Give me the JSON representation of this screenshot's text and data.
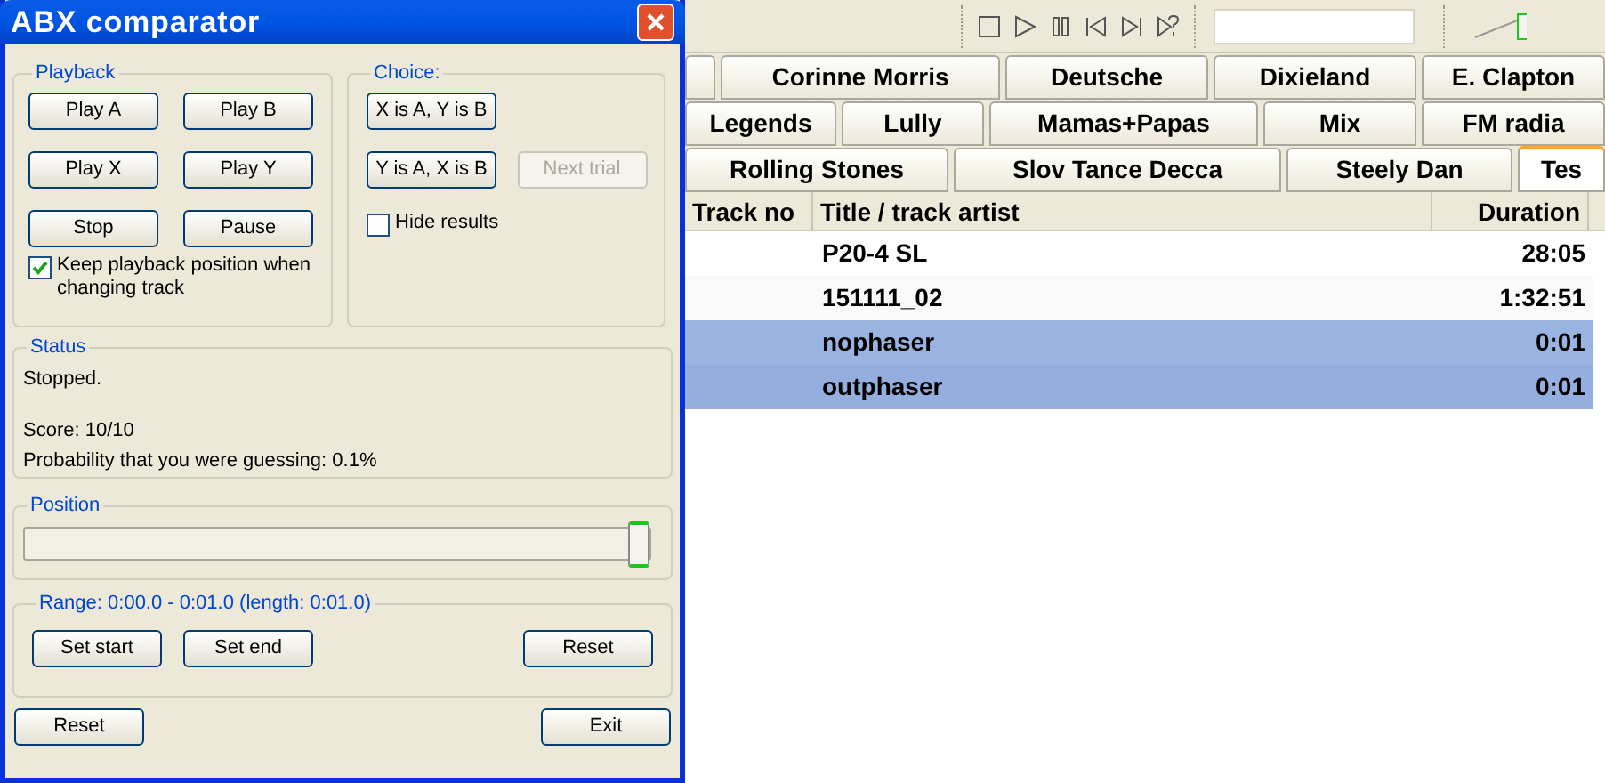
{
  "dialog": {
    "title": "ABX comparator",
    "playback": {
      "label": "Playback",
      "buttons": [
        "Play A",
        "Play B",
        "Play X",
        "Play Y",
        "Stop",
        "Pause"
      ],
      "keep_position": {
        "label": "Keep playback position when changing track",
        "checked": true
      }
    },
    "choice": {
      "label": "Choice:",
      "buttons": [
        {
          "label": "X is A, Y is B",
          "disabled": false
        },
        {
          "label": "Y is A, X is B",
          "disabled": false
        },
        {
          "label": "Next trial",
          "disabled": true
        }
      ],
      "hide_results": {
        "label": "Hide results",
        "checked": false
      }
    },
    "status": {
      "label": "Status",
      "state": "Stopped.",
      "score": "Score: 10/10",
      "probability": "Probability that you were guessing: 0.1%"
    },
    "position": {
      "label": "Position",
      "level": 1
    },
    "range": {
      "label": "Range: 0:00.0 - 0:01.0 (length: 0:01.0)",
      "buttons": [
        "Set start",
        "Set end",
        "Reset"
      ]
    },
    "footer_buttons": [
      "Reset",
      "Exit"
    ]
  },
  "player": {
    "tab_rows": [
      [
        {
          "label": "Corinne Morris",
          "selected": false
        },
        {
          "label": "Deutsche",
          "selected": false
        },
        {
          "label": "Dixieland",
          "selected": false
        },
        {
          "label": "E. Clapton",
          "selected": false
        }
      ],
      [
        {
          "label": "Legends",
          "selected": false
        },
        {
          "label": "Lully",
          "selected": false
        },
        {
          "label": "Mamas+Papas",
          "selected": false
        },
        {
          "label": "Mix",
          "selected": false
        },
        {
          "label": "FM radia",
          "selected": false
        }
      ],
      [
        {
          "label": "Rolling Stones",
          "selected": false
        },
        {
          "label": "Slov Tance Decca",
          "selected": false
        },
        {
          "label": "Steely Dan",
          "selected": false
        },
        {
          "label": "Tes",
          "selected": true
        }
      ]
    ],
    "columns": [
      "Track no",
      "Title / track artist",
      "Duration"
    ],
    "rows": [
      {
        "title": "P20-4 SL",
        "duration": "28:05",
        "selected": false
      },
      {
        "title": "151111_02",
        "duration": "1:32:51",
        "selected": false
      },
      {
        "title": "nophaser",
        "duration": "0:01",
        "selected": true
      },
      {
        "title": "outphaser",
        "duration": "0:01",
        "selected": true
      }
    ]
  }
}
